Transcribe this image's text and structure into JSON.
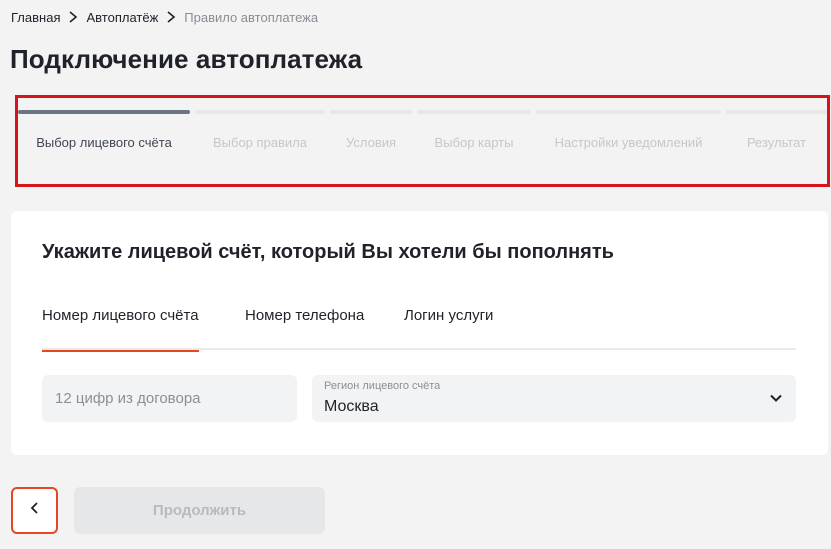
{
  "breadcrumb": {
    "items": [
      {
        "label": "Главная"
      },
      {
        "label": "Автоплатёж"
      },
      {
        "label": "Правило автоплатежа"
      }
    ]
  },
  "page": {
    "title": "Подключение автоплатежа"
  },
  "stepper": {
    "steps": [
      {
        "label": "Выбор лицевого счёта",
        "active": true
      },
      {
        "label": "Выбор правила",
        "active": false
      },
      {
        "label": "Условия",
        "active": false
      },
      {
        "label": "Выбор карты",
        "active": false
      },
      {
        "label": "Настройки уведомлений",
        "active": false
      },
      {
        "label": "Результат",
        "active": false
      }
    ]
  },
  "form": {
    "title": "Укажите лицевой счёт, который Вы хотели бы пополнять",
    "tabs": [
      {
        "label": "Номер лицевого счёта",
        "active": true
      },
      {
        "label": "Номер телефона",
        "active": false
      },
      {
        "label": "Логин услуги",
        "active": false
      }
    ],
    "account_input": {
      "value": "",
      "placeholder": "12 цифр из договора"
    },
    "region_select": {
      "label": "Регион лицевого счёта",
      "value": "Москва"
    }
  },
  "actions": {
    "continue_label": "Продолжить"
  },
  "colors": {
    "accent": "#e8461e",
    "highlight_border": "#d8131b",
    "active_step": "#6c7584",
    "page_background": "#f3f3f4"
  },
  "icons": {
    "breadcrumb_separator": "chevron-right-icon",
    "region_dropdown": "chevron-down-icon",
    "back": "chevron-left-icon"
  }
}
